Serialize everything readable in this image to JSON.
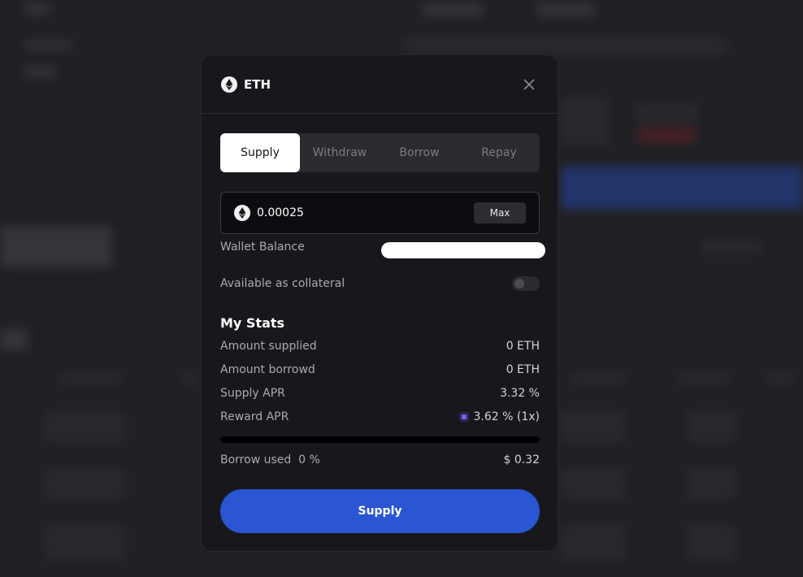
{
  "modal": {
    "token": "ETH",
    "tabs": [
      {
        "label": "Supply",
        "active": true
      },
      {
        "label": "Withdraw",
        "active": false
      },
      {
        "label": "Borrow",
        "active": false
      },
      {
        "label": "Repay",
        "active": false
      }
    ],
    "amount_value": "0.00025",
    "max_label": "Max",
    "wallet_balance_label": "Wallet Balance",
    "collateral_label": "Available as collateral",
    "collateral_enabled": false,
    "stats_title": "My Stats",
    "stats": {
      "amount_supplied_label": "Amount supplied",
      "amount_supplied_value": "0 ETH",
      "amount_borrowed_label": "Amount borrowd",
      "amount_borrowed_value": "0 ETH",
      "supply_apr_label": "Supply APR",
      "supply_apr_value": "3.32 %",
      "reward_apr_label": "Reward APR",
      "reward_apr_value": "3.62 % (1x)"
    },
    "borrow_used_label": "Borrow used",
    "borrow_used_value": "0 %",
    "borrow_used_fraction": 0,
    "borrow_amount": "$ 0.32",
    "submit_label": "Supply"
  },
  "icons": {
    "token": "ethereum-icon",
    "close": "close-icon",
    "reward": "reward-token-icon"
  },
  "colors": {
    "accent": "#2a56d3",
    "modal_bg": "#18181c",
    "active_tab_bg": "#ffffff"
  }
}
